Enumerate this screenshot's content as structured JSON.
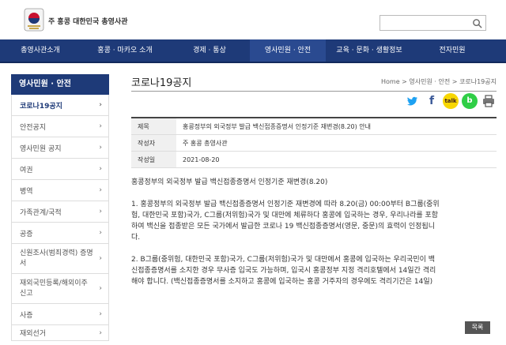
{
  "header": {
    "org_name": "주 홍콩 대한민국 총영사관",
    "search": {
      "value": "",
      "placeholder": ""
    }
  },
  "topnav": [
    "총영사관소개",
    "홍콩 · 마카오 소개",
    "경제 · 통상",
    "영사민원 · 안전",
    "교육 · 문화 · 생활정보",
    "전자민원"
  ],
  "sidebar": {
    "title": "영사민원 · 안전",
    "items": [
      {
        "label": "코로나19공지"
      },
      {
        "label": "안전공지"
      },
      {
        "label": "영사민원 공지"
      },
      {
        "label": "여권"
      },
      {
        "label": "병역"
      },
      {
        "label": "가족관계/국적"
      },
      {
        "label": "공증"
      },
      {
        "label": "신원조사(범죄경력) 증명서"
      },
      {
        "label": "재외국민등록/해외이주신고"
      },
      {
        "label": "사증"
      },
      {
        "label": "재외선거"
      }
    ]
  },
  "content": {
    "page_title": "코로나19공지",
    "breadcrumb": "Home > 영사민원 · 안전 > 코로나19공지",
    "share": {
      "kakao": "talk"
    },
    "info": [
      {
        "label": "제목",
        "value": "홍콩정부의 외국정부 발급 백신접종증명서 인정기준 재변경(8.20) 안내"
      },
      {
        "label": "작성자",
        "value": "주 홍콩 총영사관"
      },
      {
        "label": "작성일",
        "value": "2021-08-20"
      }
    ],
    "body": {
      "heading": "홍콩정부의 외국정부 발급 백신접종증명서 인정기준 재변경(8.20)",
      "p1": [
        "1. 홍콩정부의 외국정부 발급 백신접종증명서 인정기준 재변경에 따라 8.20(금) 00:00부터 B그룹(중위",
        "험, 대한민국 포함)국가, C그룹(저위험)국가 및 대만에 체류하다 홍콩에 입국하는 경우, 우리나라를 포함",
        "하여 백신을 접종받은 모든 국가에서 발급한 코로나 19 백신접종증명서(영문, 중문)의 효력이 인정됩니",
        "다."
      ],
      "p2": [
        "2. B그룹(중위험, 대한민국 포함)국가, C그룹(저위험)국가 및 대만에서 홍콩에 입국하는 우리국민이 백",
        "신접종증명서를 소지한 경우 무사증 입국도 가능하며, 입국시 홍콩정부 지정 격리호텔에서 14일간 격리",
        "해야 합니다. (백신접종증명서를 소지하고 홍콩에 입국하는 홍콩 거주자의 경우에도 격리기간은 14일)"
      ]
    },
    "list_button": "목록"
  }
}
